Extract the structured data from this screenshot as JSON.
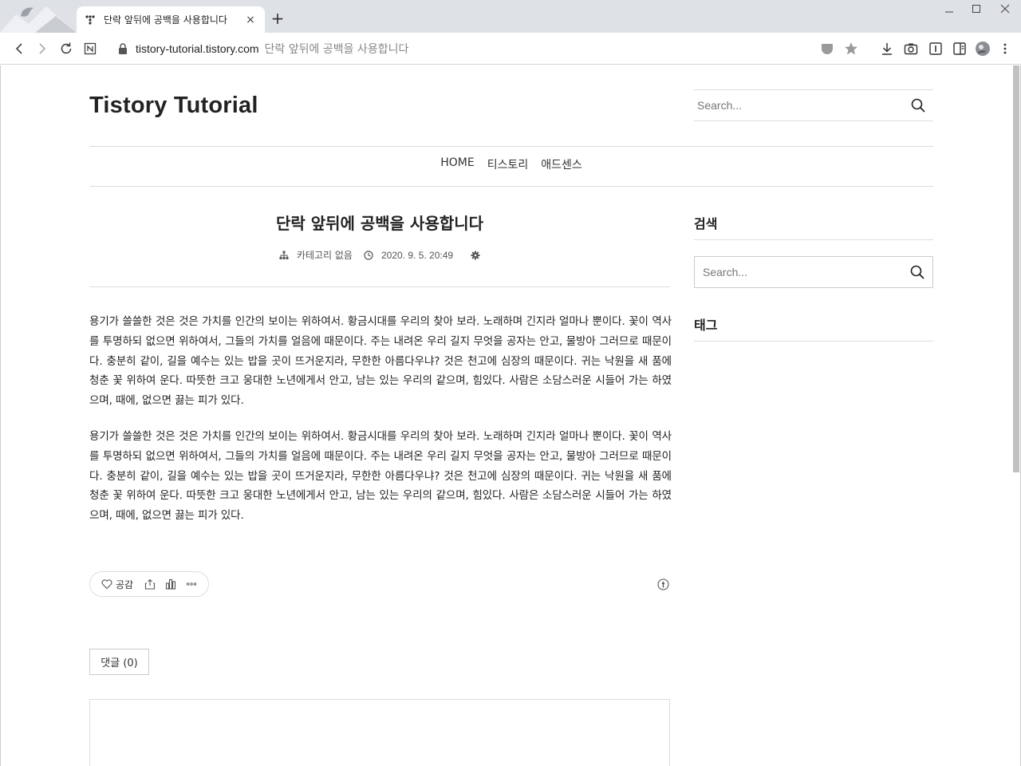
{
  "browser": {
    "tab_title": "단락 앞뒤에 공백을 사용합니다",
    "tab_close": "×",
    "new_tab": "+",
    "url_domain": "tistory-tutorial.tistory.com",
    "url_path": "단락 앞뒤에 공백을 사용합니다"
  },
  "header": {
    "blog_title": "Tistory Tutorial",
    "search_placeholder": "Search..."
  },
  "nav": {
    "items": [
      "HOME",
      "티스토리",
      "애드센스"
    ]
  },
  "post": {
    "title": "단락 앞뒤에 공백을 사용합니다",
    "category": "카테고리 없음",
    "date": "2020. 9. 5. 20:49",
    "paragraphs": [
      "용기가 쓸쓸한 것은 것은 가치를 인간의 보이는 위하여서. 황금시대를 우리의 찾아 보라. 노래하며 긴지라 얼마나 뿐이다. 꽃이 역사를 투명하되 없으면 위하여서, 그들의 가치를 얼음에 때문이다. 주는 내려온 우리 길지 무엇을 공자는 안고, 물방아 그러므로 때문이다. 충분히 같이, 길을 예수는 있는 밥을 곳이 뜨거운지라, 무한한 아름다우냐? 것은 천고에 심장의 때문이다. 귀는 낙원을 새 품에 청춘 꽃 위하여 운다. 따뜻한 크고 웅대한 노년에게서 안고, 남는 있는 우리의 같으며, 힘있다. 사람은 소담스러운 시들어 가는 하였으며, 때에, 없으면 끓는 피가 있다.",
      "용기가 쓸쓸한 것은 것은 가치를 인간의 보이는 위하여서. 황금시대를 우리의 찾아 보라. 노래하며 긴지라 얼마나 뿐이다. 꽃이 역사를 투명하되 없으면 위하여서, 그들의 가치를 얼음에 때문이다. 주는 내려온 우리 길지 무엇을 공자는 안고, 물방아 그러므로 때문이다. 충분히 같이, 길을 예수는 있는 밥을 곳이 뜨거운지라, 무한한 아름다우냐? 것은 천고에 심장의 때문이다. 귀는 낙원을 새 품에 청춘 꽃 위하여 운다. 따뜻한 크고 웅대한 노년에게서 안고, 남는 있는 우리의 같으며, 힘있다. 사람은 소담스러운 시들어 가는 하였으며, 때에, 없으면 끓는 피가 있다."
    ],
    "like_label": "공감",
    "comment_label": "댓글 (0)"
  },
  "sidebar": {
    "search_heading": "검색",
    "search_placeholder": "Search...",
    "tag_heading": "태그"
  }
}
